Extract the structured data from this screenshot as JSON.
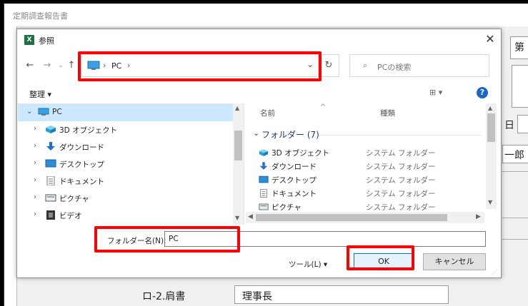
{
  "background": {
    "title": "定期調査報告書",
    "right_tab_text": "第",
    "day_text": "日",
    "person_text": "一郎",
    "position_label": "ロ-2.肩書",
    "position_value": "理事長"
  },
  "dialog": {
    "title": "参照",
    "excel_icon_text": "X",
    "close_glyph": "✕",
    "address": {
      "path": "PC",
      "separator": "›",
      "dropdown": "⌄"
    },
    "refresh_glyph": "↻",
    "search_placeholder": "PCの検索",
    "search_glyph": "⌕",
    "organize_label": "整理 ▾",
    "view_label": "⊞ ▾",
    "help_label": "?",
    "nav_tree": [
      {
        "label": "PC",
        "expanded": true,
        "selected": true,
        "icon": "pc-icon"
      },
      {
        "label": "3D オブジェクト",
        "icon": "3d-objects-icon"
      },
      {
        "label": "ダウンロード",
        "icon": "download-icon"
      },
      {
        "label": "デスクトップ",
        "icon": "desktop-icon"
      },
      {
        "label": "ドキュメント",
        "icon": "document-icon"
      },
      {
        "label": "ピクチャ",
        "icon": "pictures-icon"
      },
      {
        "label": "ビデオ",
        "icon": "video-icon"
      }
    ],
    "columns": {
      "name": "名前",
      "type": "種類"
    },
    "group_label": "フォルダー (7)",
    "files": [
      {
        "name": "3D オブジェクト",
        "type": "システム フォルダー",
        "icon": "3d-objects-icon"
      },
      {
        "name": "ダウンロード",
        "type": "システム フォルダー",
        "icon": "download-icon"
      },
      {
        "name": "デスクトップ",
        "type": "システム フォルダー",
        "icon": "desktop-icon"
      },
      {
        "name": "ドキュメント",
        "type": "システム フォルダー",
        "icon": "document-icon"
      },
      {
        "name": "ピクチャ",
        "type": "システム フォルダー",
        "icon": "pictures-icon"
      }
    ],
    "folder_name_label": "フォルダー名(N):",
    "folder_name_value": "PC",
    "tools_label": "ツール(L)  ▾",
    "ok_label": "OK",
    "cancel_label": "キャンセル"
  },
  "colors": {
    "highlight": "#ff0000",
    "selection": "#cce8ff",
    "accent": "#0078d7"
  }
}
